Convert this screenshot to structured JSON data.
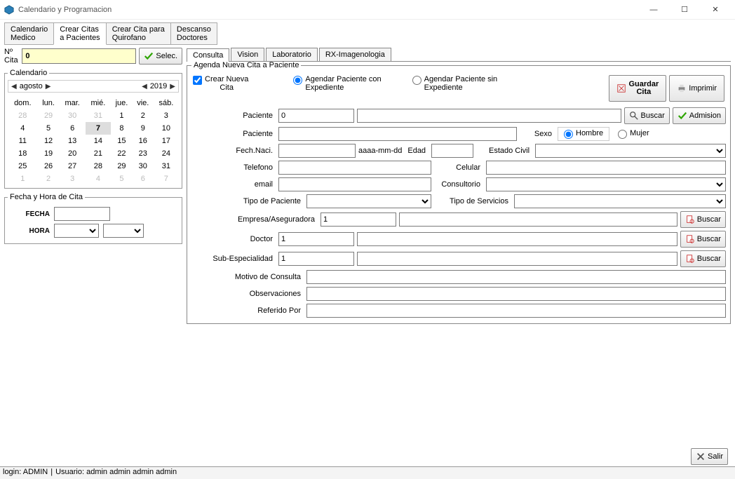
{
  "window": {
    "title": "Calendario y Programacion"
  },
  "winbtns": {
    "min": "—",
    "max": "☐",
    "close": "✕"
  },
  "main_tabs": [
    "Calendario\nMedico",
    "Crear Citas\na Pacientes",
    "Crear Cita para\nQuirofano",
    "Descanso\nDoctores"
  ],
  "main_tab_active": 1,
  "cita": {
    "label": "Nº Cita",
    "value": "0",
    "selec": "Selec."
  },
  "calendario": {
    "legend": "Calendario",
    "month": "agosto",
    "year": "2019",
    "dow": [
      "dom.",
      "lun.",
      "mar.",
      "mié.",
      "jue.",
      "vie.",
      "sáb."
    ],
    "weeks": [
      [
        {
          "d": "28",
          "dim": true
        },
        {
          "d": "29",
          "dim": true
        },
        {
          "d": "30",
          "dim": true
        },
        {
          "d": "31",
          "dim": true
        },
        {
          "d": "1"
        },
        {
          "d": "2"
        },
        {
          "d": "3"
        }
      ],
      [
        {
          "d": "4"
        },
        {
          "d": "5"
        },
        {
          "d": "6"
        },
        {
          "d": "7",
          "today": true
        },
        {
          "d": "8"
        },
        {
          "d": "9"
        },
        {
          "d": "10"
        }
      ],
      [
        {
          "d": "11"
        },
        {
          "d": "12"
        },
        {
          "d": "13"
        },
        {
          "d": "14"
        },
        {
          "d": "15"
        },
        {
          "d": "16"
        },
        {
          "d": "17"
        }
      ],
      [
        {
          "d": "18"
        },
        {
          "d": "19"
        },
        {
          "d": "20"
        },
        {
          "d": "21"
        },
        {
          "d": "22"
        },
        {
          "d": "23"
        },
        {
          "d": "24"
        }
      ],
      [
        {
          "d": "25"
        },
        {
          "d": "26"
        },
        {
          "d": "27"
        },
        {
          "d": "28"
        },
        {
          "d": "29"
        },
        {
          "d": "30"
        },
        {
          "d": "31"
        }
      ],
      [
        {
          "d": "1",
          "dim": true
        },
        {
          "d": "2",
          "dim": true
        },
        {
          "d": "3",
          "dim": true
        },
        {
          "d": "4",
          "dim": true
        },
        {
          "d": "5",
          "dim": true
        },
        {
          "d": "6",
          "dim": true
        },
        {
          "d": "7",
          "dim": true
        }
      ]
    ]
  },
  "fechahora": {
    "legend": "Fecha y Hora de Cita",
    "fecha_label": "FECHA",
    "hora_label": "HORA"
  },
  "sub_tabs": [
    "Consulta",
    "Vision",
    "Laboratorio",
    "RX-Imagenologia"
  ],
  "sub_tab_active": 0,
  "agenda": {
    "legend": "Agenda Nueva Cita a Paciente",
    "opt1": "Crear Nueva\nCita",
    "opt2": "Agendar Paciente con\nExpediente",
    "opt3": "Agendar Paciente sin\nExpediente",
    "guardar": "Guardar\nCita",
    "imprimir": "Imprimir",
    "paciente_lbl": "Paciente",
    "paciente_id": "0",
    "buscar": "Buscar",
    "admision": "Admision",
    "paciente2_lbl": "Paciente",
    "sexo_lbl": "Sexo",
    "hombre": "Hombre",
    "mujer": "Mujer",
    "fechnaci": "Fech.Naci.",
    "date_ph": "aaaa-mm-dd",
    "edad": "Edad",
    "estadocivil": "Estado Civil",
    "telefono": "Telefono",
    "celular": "Celular",
    "email": "email",
    "consultorio": "Consultorio",
    "tipopaciente": "Tipo de Paciente",
    "tiposervicios": "Tipo de Servicios",
    "empresa": "Empresa/Aseguradora",
    "empresa_id": "1",
    "doctor": "Doctor",
    "doctor_id": "1",
    "subesp": "Sub-Especialidad",
    "subesp_id": "1",
    "motivo": "Motivo de Consulta",
    "observ": "Observaciones",
    "referido": "Referido Por"
  },
  "salir": "Salir",
  "status": {
    "login": "login: ADMIN",
    "usuario": "Usuario: admin admin admin admin"
  }
}
